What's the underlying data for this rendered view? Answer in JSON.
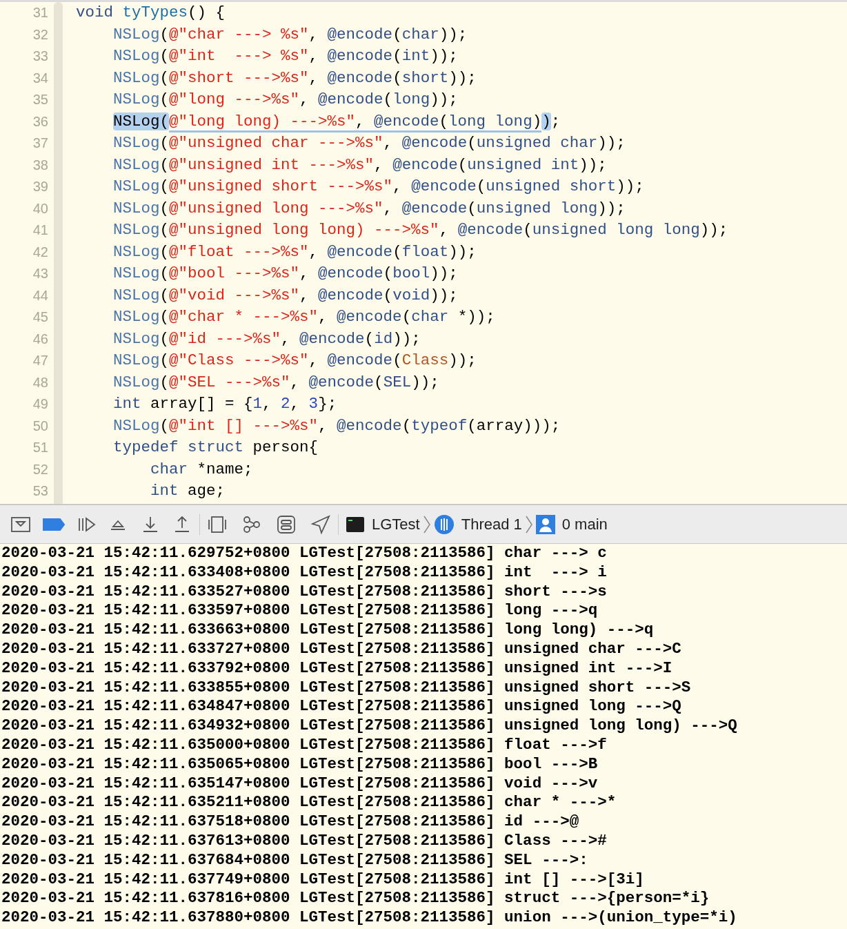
{
  "editor": {
    "lines": [
      {
        "number": "31",
        "tokens": [
          {
            "kind": "kw",
            "text": "void"
          },
          {
            "kind": "fn",
            "text": " tyTypes"
          },
          {
            "kind": "p",
            "text": "() {"
          }
        ]
      },
      {
        "number": "32",
        "tokens": [
          {
            "kind": "macro",
            "text": "    NSLog"
          },
          {
            "kind": "p",
            "text": "("
          },
          {
            "kind": "str",
            "text": "@\"char ---> %s\""
          },
          {
            "kind": "p",
            "text": ", "
          },
          {
            "kind": "dir",
            "text": "@encode"
          },
          {
            "kind": "p",
            "text": "("
          },
          {
            "kind": "kw",
            "text": "char"
          },
          {
            "kind": "p",
            "text": "));"
          }
        ]
      },
      {
        "number": "33",
        "tokens": [
          {
            "kind": "macro",
            "text": "    NSLog"
          },
          {
            "kind": "p",
            "text": "("
          },
          {
            "kind": "str",
            "text": "@\"int  ---> %s\""
          },
          {
            "kind": "p",
            "text": ", "
          },
          {
            "kind": "dir",
            "text": "@encode"
          },
          {
            "kind": "p",
            "text": "("
          },
          {
            "kind": "kw",
            "text": "int"
          },
          {
            "kind": "p",
            "text": "));"
          }
        ]
      },
      {
        "number": "34",
        "tokens": [
          {
            "kind": "macro",
            "text": "    NSLog"
          },
          {
            "kind": "p",
            "text": "("
          },
          {
            "kind": "str",
            "text": "@\"short --->%s\""
          },
          {
            "kind": "p",
            "text": ", "
          },
          {
            "kind": "dir",
            "text": "@encode"
          },
          {
            "kind": "p",
            "text": "("
          },
          {
            "kind": "kw",
            "text": "short"
          },
          {
            "kind": "p",
            "text": "));"
          }
        ]
      },
      {
        "number": "35",
        "tokens": [
          {
            "kind": "macro",
            "text": "    NSLog"
          },
          {
            "kind": "p",
            "text": "("
          },
          {
            "kind": "str",
            "text": "@\"long --->%s\""
          },
          {
            "kind": "p",
            "text": ", "
          },
          {
            "kind": "dir",
            "text": "@encode"
          },
          {
            "kind": "p",
            "text": "("
          },
          {
            "kind": "kw",
            "text": "long"
          },
          {
            "kind": "p",
            "text": "));"
          }
        ]
      },
      {
        "number": "36",
        "tokens": [
          {
            "kind": "sel-indented",
            "text": "NSLog("
          },
          {
            "kind": "match",
            "tokens": [
              {
                "kind": "str",
                "text": "@\"long long) --->%s\""
              },
              {
                "kind": "p",
                "text": ", "
              },
              {
                "kind": "dir",
                "text": "@encode"
              },
              {
                "kind": "p",
                "text": "("
              },
              {
                "kind": "kw",
                "text": "long long"
              },
              {
                "kind": "p",
                "text": ")"
              }
            ]
          },
          {
            "kind": "sel",
            "text": ")"
          },
          {
            "kind": "p",
            "text": ";"
          }
        ]
      },
      {
        "number": "37",
        "tokens": [
          {
            "kind": "macro",
            "text": "    NSLog"
          },
          {
            "kind": "p",
            "text": "("
          },
          {
            "kind": "str",
            "text": "@\"unsigned char --->%s\""
          },
          {
            "kind": "p",
            "text": ", "
          },
          {
            "kind": "dir",
            "text": "@encode"
          },
          {
            "kind": "p",
            "text": "("
          },
          {
            "kind": "kw",
            "text": "unsigned char"
          },
          {
            "kind": "p",
            "text": "));"
          }
        ]
      },
      {
        "number": "38",
        "tokens": [
          {
            "kind": "macro",
            "text": "    NSLog"
          },
          {
            "kind": "p",
            "text": "("
          },
          {
            "kind": "str",
            "text": "@\"unsigned int --->%s\""
          },
          {
            "kind": "p",
            "text": ", "
          },
          {
            "kind": "dir",
            "text": "@encode"
          },
          {
            "kind": "p",
            "text": "("
          },
          {
            "kind": "kw",
            "text": "unsigned int"
          },
          {
            "kind": "p",
            "text": "));"
          }
        ]
      },
      {
        "number": "39",
        "tokens": [
          {
            "kind": "macro",
            "text": "    NSLog"
          },
          {
            "kind": "p",
            "text": "("
          },
          {
            "kind": "str",
            "text": "@\"unsigned short --->%s\""
          },
          {
            "kind": "p",
            "text": ", "
          },
          {
            "kind": "dir",
            "text": "@encode"
          },
          {
            "kind": "p",
            "text": "("
          },
          {
            "kind": "kw",
            "text": "unsigned short"
          },
          {
            "kind": "p",
            "text": "));"
          }
        ]
      },
      {
        "number": "40",
        "tokens": [
          {
            "kind": "macro",
            "text": "    NSLog"
          },
          {
            "kind": "p",
            "text": "("
          },
          {
            "kind": "str",
            "text": "@\"unsigned long --->%s\""
          },
          {
            "kind": "p",
            "text": ", "
          },
          {
            "kind": "dir",
            "text": "@encode"
          },
          {
            "kind": "p",
            "text": "("
          },
          {
            "kind": "kw",
            "text": "unsigned long"
          },
          {
            "kind": "p",
            "text": "));"
          }
        ]
      },
      {
        "number": "41",
        "tokens": [
          {
            "kind": "macro",
            "text": "    NSLog"
          },
          {
            "kind": "p",
            "text": "("
          },
          {
            "kind": "str",
            "text": "@\"unsigned long long) --->%s\""
          },
          {
            "kind": "p",
            "text": ", "
          },
          {
            "kind": "dir",
            "text": "@encode"
          },
          {
            "kind": "p",
            "text": "("
          },
          {
            "kind": "kw",
            "text": "unsigned long long"
          },
          {
            "kind": "p",
            "text": "));"
          }
        ]
      },
      {
        "number": "42",
        "tokens": [
          {
            "kind": "macro",
            "text": "    NSLog"
          },
          {
            "kind": "p",
            "text": "("
          },
          {
            "kind": "str",
            "text": "@\"float --->%s\""
          },
          {
            "kind": "p",
            "text": ", "
          },
          {
            "kind": "dir",
            "text": "@encode"
          },
          {
            "kind": "p",
            "text": "("
          },
          {
            "kind": "kw",
            "text": "float"
          },
          {
            "kind": "p",
            "text": "));"
          }
        ]
      },
      {
        "number": "43",
        "tokens": [
          {
            "kind": "macro",
            "text": "    NSLog"
          },
          {
            "kind": "p",
            "text": "("
          },
          {
            "kind": "str",
            "text": "@\"bool --->%s\""
          },
          {
            "kind": "p",
            "text": ", "
          },
          {
            "kind": "dir",
            "text": "@encode"
          },
          {
            "kind": "p",
            "text": "("
          },
          {
            "kind": "kw",
            "text": "bool"
          },
          {
            "kind": "p",
            "text": "));"
          }
        ]
      },
      {
        "number": "44",
        "tokens": [
          {
            "kind": "macro",
            "text": "    NSLog"
          },
          {
            "kind": "p",
            "text": "("
          },
          {
            "kind": "str",
            "text": "@\"void --->%s\""
          },
          {
            "kind": "p",
            "text": ", "
          },
          {
            "kind": "dir",
            "text": "@encode"
          },
          {
            "kind": "p",
            "text": "("
          },
          {
            "kind": "kw",
            "text": "void"
          },
          {
            "kind": "p",
            "text": "));"
          }
        ]
      },
      {
        "number": "45",
        "tokens": [
          {
            "kind": "macro",
            "text": "    NSLog"
          },
          {
            "kind": "p",
            "text": "("
          },
          {
            "kind": "str",
            "text": "@\"char * --->%s\""
          },
          {
            "kind": "p",
            "text": ", "
          },
          {
            "kind": "dir",
            "text": "@encode"
          },
          {
            "kind": "p",
            "text": "("
          },
          {
            "kind": "kw",
            "text": "char"
          },
          {
            "kind": "p",
            "text": " *));"
          }
        ]
      },
      {
        "number": "46",
        "tokens": [
          {
            "kind": "macro",
            "text": "    NSLog"
          },
          {
            "kind": "p",
            "text": "("
          },
          {
            "kind": "str",
            "text": "@\"id --->%s\""
          },
          {
            "kind": "p",
            "text": ", "
          },
          {
            "kind": "dir",
            "text": "@encode"
          },
          {
            "kind": "p",
            "text": "("
          },
          {
            "kind": "kw",
            "text": "id"
          },
          {
            "kind": "p",
            "text": "));"
          }
        ]
      },
      {
        "number": "47",
        "tokens": [
          {
            "kind": "macro",
            "text": "    NSLog"
          },
          {
            "kind": "p",
            "text": "("
          },
          {
            "kind": "str",
            "text": "@\"Class --->%s\""
          },
          {
            "kind": "p",
            "text": ", "
          },
          {
            "kind": "dir",
            "text": "@encode"
          },
          {
            "kind": "p",
            "text": "("
          },
          {
            "kind": "type",
            "text": "Class"
          },
          {
            "kind": "p",
            "text": "));"
          }
        ]
      },
      {
        "number": "48",
        "tokens": [
          {
            "kind": "macro",
            "text": "    NSLog"
          },
          {
            "kind": "p",
            "text": "("
          },
          {
            "kind": "str",
            "text": "@\"SEL --->%s\""
          },
          {
            "kind": "p",
            "text": ", "
          },
          {
            "kind": "dir",
            "text": "@encode"
          },
          {
            "kind": "p",
            "text": "("
          },
          {
            "kind": "kw",
            "text": "SEL"
          },
          {
            "kind": "p",
            "text": "));"
          }
        ]
      },
      {
        "number": "49",
        "tokens": [
          {
            "kind": "kw",
            "text": "    int"
          },
          {
            "kind": "p",
            "text": " array[] = {"
          },
          {
            "kind": "num",
            "text": "1"
          },
          {
            "kind": "p",
            "text": ", "
          },
          {
            "kind": "num",
            "text": "2"
          },
          {
            "kind": "p",
            "text": ", "
          },
          {
            "kind": "num",
            "text": "3"
          },
          {
            "kind": "p",
            "text": "};"
          }
        ]
      },
      {
        "number": "50",
        "tokens": [
          {
            "kind": "macro",
            "text": "    NSLog"
          },
          {
            "kind": "p",
            "text": "("
          },
          {
            "kind": "str",
            "text": "@\"int [] --->%s\""
          },
          {
            "kind": "p",
            "text": ", "
          },
          {
            "kind": "dir",
            "text": "@encode"
          },
          {
            "kind": "p",
            "text": "("
          },
          {
            "kind": "kw",
            "text": "typeof"
          },
          {
            "kind": "p",
            "text": "(array)));"
          }
        ]
      },
      {
        "number": "51",
        "tokens": [
          {
            "kind": "kw",
            "text": "    typedef struct"
          },
          {
            "kind": "p",
            "text": " person{"
          }
        ]
      },
      {
        "number": "52",
        "tokens": [
          {
            "kind": "kw",
            "text": "        char"
          },
          {
            "kind": "p",
            "text": " *name;"
          }
        ]
      },
      {
        "number": "53",
        "tokens": [
          {
            "kind": "kw",
            "text": "        int"
          },
          {
            "kind": "p",
            "text": " age;"
          }
        ]
      }
    ]
  },
  "debug_bar": {
    "breakpoints_active": true,
    "crumbs": [
      {
        "kind": "app",
        "label": "LGTest"
      },
      {
        "kind": "thread",
        "label": "Thread 1"
      },
      {
        "kind": "frame",
        "label": "0 main"
      }
    ]
  },
  "console": {
    "lines": [
      "2020-03-21 15:42:11.629752+0800 LGTest[27508:2113586] char ---> c",
      "2020-03-21 15:42:11.633408+0800 LGTest[27508:2113586] int  ---> i",
      "2020-03-21 15:42:11.633527+0800 LGTest[27508:2113586] short --->s",
      "2020-03-21 15:42:11.633597+0800 LGTest[27508:2113586] long --->q",
      "2020-03-21 15:42:11.633663+0800 LGTest[27508:2113586] long long) --->q",
      "2020-03-21 15:42:11.633727+0800 LGTest[27508:2113586] unsigned char --->C",
      "2020-03-21 15:42:11.633792+0800 LGTest[27508:2113586] unsigned int --->I",
      "2020-03-21 15:42:11.633855+0800 LGTest[27508:2113586] unsigned short --->S",
      "2020-03-21 15:42:11.634847+0800 LGTest[27508:2113586] unsigned long --->Q",
      "2020-03-21 15:42:11.634932+0800 LGTest[27508:2113586] unsigned long long) --->Q",
      "2020-03-21 15:42:11.635000+0800 LGTest[27508:2113586] float --->f",
      "2020-03-21 15:42:11.635065+0800 LGTest[27508:2113586] bool --->B",
      "2020-03-21 15:42:11.635147+0800 LGTest[27508:2113586] void --->v",
      "2020-03-21 15:42:11.635211+0800 LGTest[27508:2113586] char * --->*",
      "2020-03-21 15:42:11.637518+0800 LGTest[27508:2113586] id --->@",
      "2020-03-21 15:42:11.637613+0800 LGTest[27508:2113586] Class --->#",
      "2020-03-21 15:42:11.637684+0800 LGTest[27508:2113586] SEL --->:",
      "2020-03-21 15:42:11.637749+0800 LGTest[27508:2113586] int [] --->[3i]",
      "2020-03-21 15:42:11.637816+0800 LGTest[27508:2113586] struct --->{person=*i}",
      "2020-03-21 15:42:11.637880+0800 LGTest[27508:2113586] union --->(union_type=*i)"
    ]
  }
}
